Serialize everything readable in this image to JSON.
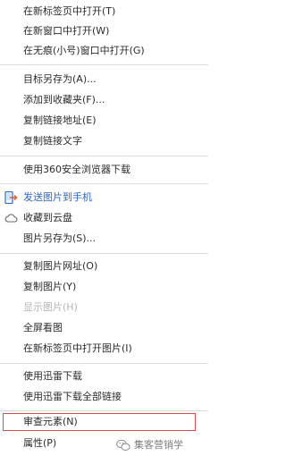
{
  "menu": {
    "items": [
      {
        "label": "在新标签页中打开(T)"
      },
      {
        "label": "在新窗口中打开(W)"
      },
      {
        "label": "在无痕(小号)窗口中打开(G)"
      },
      {
        "label": "目标另存为(A)..."
      },
      {
        "label": "添加到收藏夹(F)..."
      },
      {
        "label": "复制链接地址(E)"
      },
      {
        "label": "复制链接文字"
      },
      {
        "label": "使用360安全浏览器下载"
      },
      {
        "label": "发送图片到手机",
        "icon": "phone-share-icon"
      },
      {
        "label": "收藏到云盘",
        "icon": "cloud-icon"
      },
      {
        "label": "图片另存为(S)..."
      },
      {
        "label": "复制图片网址(O)"
      },
      {
        "label": "复制图片(Y)"
      },
      {
        "label": "显示图片(H)",
        "state": "disabled"
      },
      {
        "label": "全屏看图"
      },
      {
        "label": "在新标签页中打开图片(I)"
      },
      {
        "label": "使用迅雷下载"
      },
      {
        "label": "使用迅雷下载全部链接"
      },
      {
        "label": "审查元素(N)",
        "state": "highlighted"
      },
      {
        "label": "属性(P)"
      }
    ]
  },
  "watermark": {
    "text": "集客营销学",
    "icon": "wechat-icon"
  },
  "colors": {
    "accent_text": "#2b67c5",
    "highlight_border": "#d94a4a",
    "disabled_text": "#b4b4b4",
    "separator": "#dcdcdc"
  }
}
